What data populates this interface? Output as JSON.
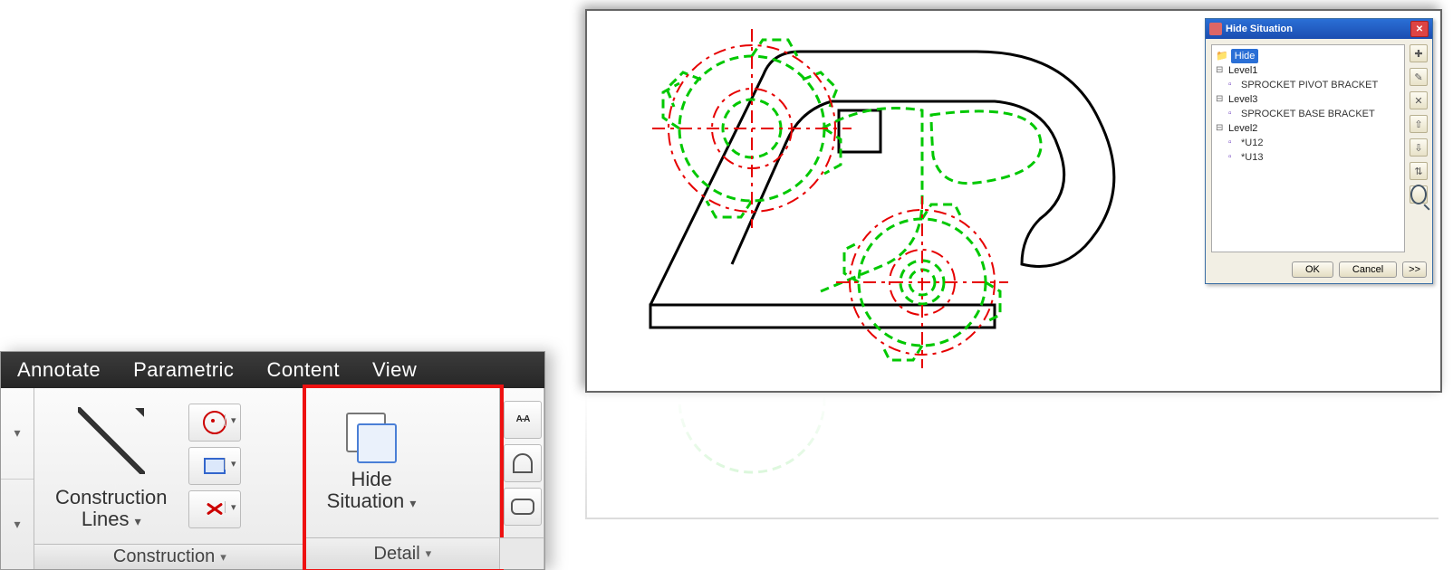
{
  "ribbon": {
    "tabs": [
      "Annotate",
      "Parametric",
      "Content",
      "View"
    ],
    "panels": {
      "construction": {
        "title": "Construction",
        "btn_label_line1": "Construction",
        "btn_label_line2": "Lines"
      },
      "detail": {
        "title": "Detail",
        "btn_label_line1": "Hide",
        "btn_label_line2": "Situation"
      }
    }
  },
  "dialog": {
    "title": "Hide Situation",
    "tree": {
      "root": "Hide",
      "levels": [
        {
          "name": "Level1",
          "items": [
            "SPROCKET PIVOT BRACKET"
          ]
        },
        {
          "name": "Level3",
          "items": [
            "SPROCKET BASE BRACKET"
          ]
        },
        {
          "name": "Level2",
          "items": [
            "*U12",
            "*U13"
          ]
        }
      ]
    },
    "ok": "OK",
    "cancel": "Cancel",
    "more": ">>"
  }
}
